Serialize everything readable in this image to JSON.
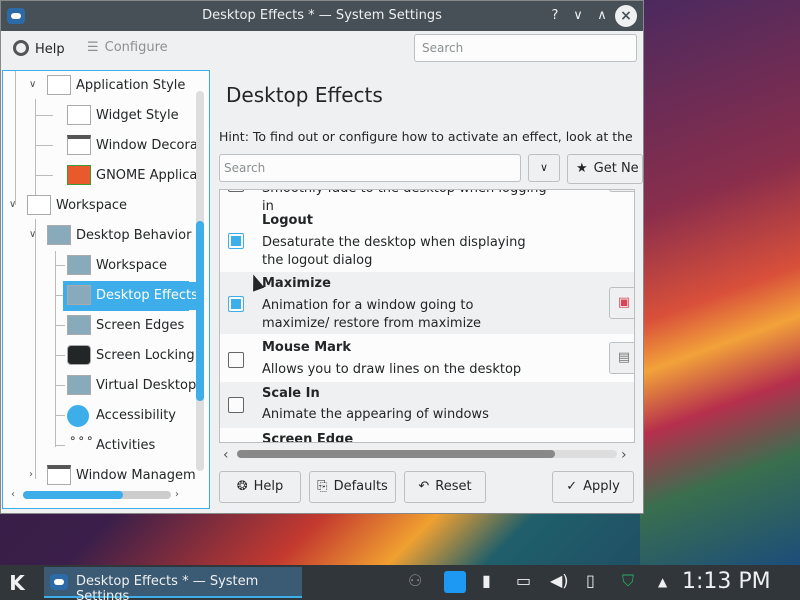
{
  "window": {
    "title": "Desktop Effects * — System Settings",
    "controls": {
      "help": "?",
      "minimize": "∨",
      "maximize": "∧",
      "close": "×"
    }
  },
  "toolbar": {
    "help_label": "Help",
    "configure_label": "Configure",
    "search_placeholder": "Search"
  },
  "sidebar": {
    "items": [
      {
        "label": "Application Style",
        "level": 1
      },
      {
        "label": "Widget Style",
        "level": 2
      },
      {
        "label": "Window Decora",
        "level": 2
      },
      {
        "label": "GNOME Applica",
        "level": 2
      },
      {
        "label": "Workspace",
        "level": 0
      },
      {
        "label": "Desktop Behavior",
        "level": 1
      },
      {
        "label": "Workspace",
        "level": 2
      },
      {
        "label": "Desktop Effects",
        "level": 2,
        "selected": true
      },
      {
        "label": "Screen Edges",
        "level": 2
      },
      {
        "label": "Screen Locking",
        "level": 2
      },
      {
        "label": "Virtual Desktop",
        "level": 2
      },
      {
        "label": "Accessibility",
        "level": 2
      },
      {
        "label": "Activities",
        "level": 2
      },
      {
        "label": "Window Managem",
        "level": 1
      }
    ]
  },
  "main": {
    "title": "Desktop Effects",
    "hint": "Hint: To find out or configure how to activate an effect, look at the effe",
    "search_placeholder": "Search",
    "get_new_label": "Get Ne",
    "effects": [
      {
        "name": "",
        "desc": "Smoothly fade to the desktop when logging in",
        "checked": false
      },
      {
        "name": "Logout",
        "desc": "Desaturate the desktop when displaying the logout dialog",
        "checked": true
      },
      {
        "name": "Maximize",
        "desc": "Animation for a window going to maximize/ restore from maximize",
        "checked": true
      },
      {
        "name": "Mouse Mark",
        "desc": "Allows you to draw lines on the desktop",
        "checked": false
      },
      {
        "name": "Scale In",
        "desc": "Animate the appearing of windows",
        "checked": false
      },
      {
        "name": "Screen Edge",
        "desc": "",
        "checked": false
      }
    ]
  },
  "buttons": {
    "help": "Help",
    "defaults": "Defaults",
    "reset": "Reset",
    "apply": "Apply"
  },
  "taskbar": {
    "task_label": "Desktop Effects * — System Settings",
    "clock": "1:13 PM"
  },
  "colors": {
    "accent": "#3daee9",
    "titlebar": "#475057",
    "panel": "#31363b",
    "window_bg": "#eff0f1"
  }
}
